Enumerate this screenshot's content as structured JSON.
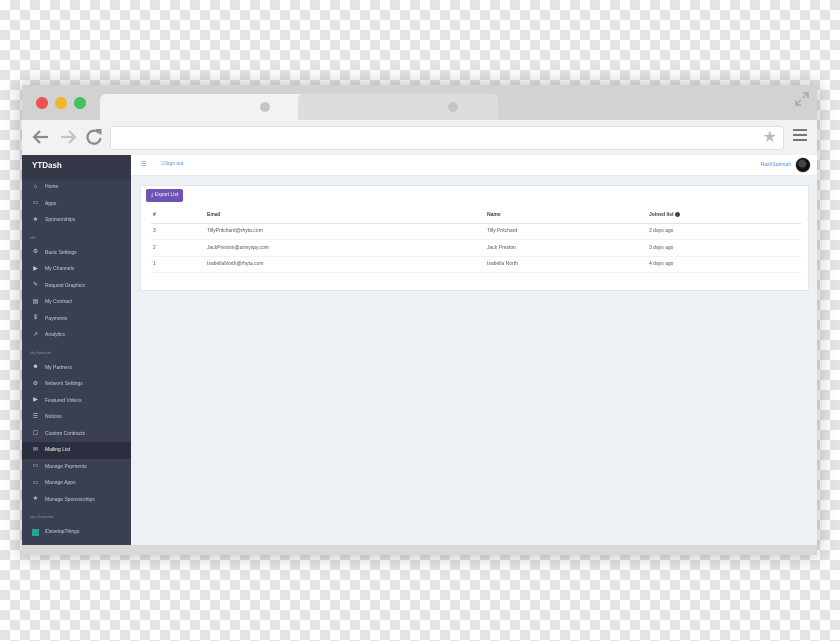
{
  "app": {
    "brand": "YTDash"
  },
  "sidebar": {
    "items": [
      {
        "label": "Home",
        "icon": "home-icon",
        "glyph": "⌂"
      },
      {
        "label": "Apps",
        "icon": "laptop-icon",
        "glyph": "▭"
      },
      {
        "label": "Sponsorships",
        "icon": "star-icon",
        "glyph": "★"
      },
      {
        "section": "Me"
      },
      {
        "label": "Basic Settings",
        "icon": "cogs-icon",
        "glyph": "⚙"
      },
      {
        "label": "My Channels",
        "icon": "youtube-icon",
        "glyph": "▶"
      },
      {
        "label": "Request Graphics",
        "icon": "paint-brush-icon",
        "glyph": "✎"
      },
      {
        "label": "My Contract",
        "icon": "file-icon",
        "glyph": "▤"
      },
      {
        "label": "Payments",
        "icon": "dollar-icon",
        "glyph": "$"
      },
      {
        "label": "Analytics",
        "icon": "area-chart-icon",
        "glyph": "↗"
      },
      {
        "section": "My Network"
      },
      {
        "label": "My Partners",
        "icon": "users-icon",
        "glyph": "☻"
      },
      {
        "label": "Network Settings",
        "icon": "cogs-icon",
        "glyph": "⚙"
      },
      {
        "label": "Featured Videos",
        "icon": "video-camera-icon",
        "glyph": "▶"
      },
      {
        "label": "Notices",
        "icon": "list-icon",
        "glyph": "☰"
      },
      {
        "label": "Custom Contracts",
        "icon": "file-icon",
        "glyph": "▢"
      },
      {
        "label": "Mailing List",
        "icon": "envelope-icon",
        "glyph": "✉",
        "active": true
      },
      {
        "label": "Manage Payments",
        "icon": "credit-card-icon",
        "glyph": "▭"
      },
      {
        "label": "Manage Apps",
        "icon": "laptop-icon",
        "glyph": "▭"
      },
      {
        "label": "Manage Sponsorships",
        "icon": "star-icon",
        "glyph": "★"
      },
      {
        "section": "My Channels"
      },
      {
        "label": "iDevelopThings",
        "icon": "channel-avatar",
        "avatar": true
      }
    ]
  },
  "topbar": {
    "signout": "Sign out",
    "username": "RashSahmah"
  },
  "main": {
    "export_label": "Export List",
    "table": {
      "headers": [
        "#",
        "Email",
        "Name",
        "Joined list"
      ],
      "rows": [
        [
          "3",
          "TillyPritchard@rhyta.com",
          "Tilly Pritchard",
          "2 days ago"
        ],
        [
          "2",
          "JackPreston@armyspy.com",
          "Jack Preston",
          "3 days ago"
        ],
        [
          "1",
          "IsabellaNorth@rhyta.com",
          "Isabella North",
          "4 days ago"
        ]
      ]
    }
  },
  "colors": {
    "sidebar_bg": "#3b3f52",
    "accent": "#6f52b5",
    "link": "#4a90e2"
  }
}
